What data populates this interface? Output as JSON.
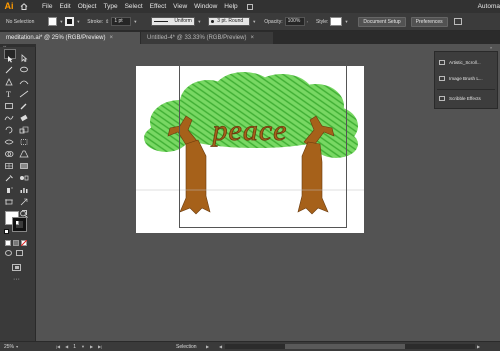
{
  "app": {
    "logo": "Ai",
    "workspace": "Automa"
  },
  "menu": [
    "File",
    "Edit",
    "Object",
    "Type",
    "Select",
    "Effect",
    "View",
    "Window",
    "Help"
  ],
  "control": {
    "selection": "No Selection",
    "stroke_label": "Stroke:",
    "stroke_value": "1 pt",
    "profile": "Uniform",
    "brush": "3 pt. Round",
    "opacity_label": "Opacity:",
    "opacity_value": "100%",
    "style_label": "Style:",
    "document_setup": "Document Setup",
    "preferences": "Preferences"
  },
  "tabs": [
    {
      "label": "meditation.ai* @ 25% (RGB/Preview)",
      "close": "×",
      "active": true
    },
    {
      "label": "Untitled-4* @ 33.33% (RGB/Preview)",
      "close": "×",
      "active": false
    }
  ],
  "panel": {
    "items": [
      {
        "label": "Artistic_Scroll..."
      },
      {
        "label": "Image Brush L..."
      },
      {
        "label": "Scribble Effects"
      }
    ]
  },
  "status": {
    "zoom": "25%",
    "page": "1",
    "mode": "Selection"
  },
  "artwork": {
    "text": "peace",
    "colors": {
      "leaves": "#5fc94e",
      "trunk": "#a6611a",
      "trunk_dark": "#6a3b0e"
    }
  }
}
